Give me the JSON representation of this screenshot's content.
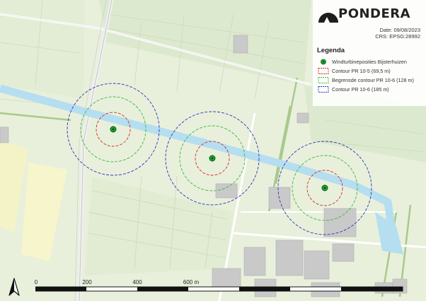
{
  "brand": {
    "name": "PONDERA"
  },
  "meta": {
    "date": "Date: 09/08/2023",
    "crs": "CRS: EPSG:28992"
  },
  "legend": {
    "title": "Legenda",
    "items": [
      {
        "label": "Windturbineposities Bijsterhuizen",
        "color": "#1aa330",
        "kind": "point"
      },
      {
        "label": "Contour PR 10-5 (69,5 m)",
        "color": "#d42a2a",
        "kind": "dashed"
      },
      {
        "label": "Begrensde contour PR 10-6 (128 m)",
        "color": "#3bb83b",
        "kind": "dashed"
      },
      {
        "label": "Contour PR 10-6 (185 m)",
        "color": "#3232b8",
        "kind": "dashed"
      }
    ]
  },
  "scalebar": {
    "labels": [
      "0",
      "200",
      "400",
      "600 m"
    ]
  },
  "colors": {
    "water": "#b5def0",
    "land": "#e8f0dc",
    "field": "#d8e8c8",
    "building": "#c8c8c8",
    "road": "#ffffff"
  }
}
